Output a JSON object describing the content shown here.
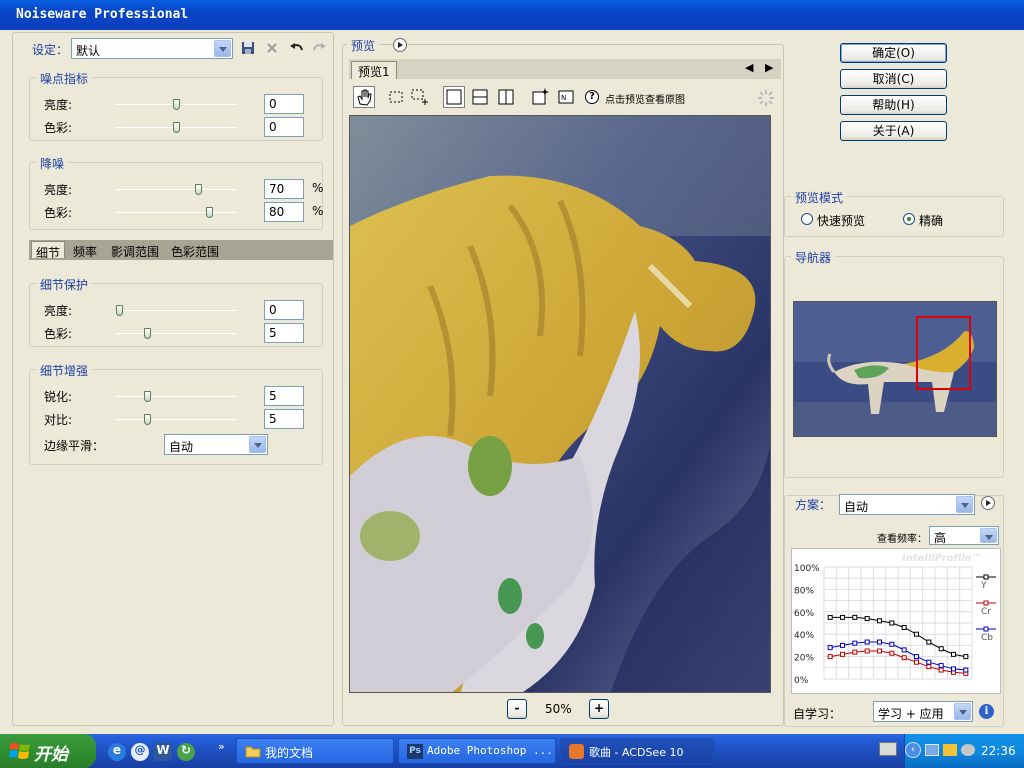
{
  "title": "Noiseware Professional",
  "left": {
    "preset_label": "设定：",
    "preset_value": "默认",
    "noise_group": "噪点指标",
    "reduce_group": "降噪",
    "brightness": "亮度:",
    "color": "色彩:",
    "noise_luma": "0",
    "noise_chroma": "0",
    "reduce_luma": "70",
    "reduce_chroma": "80",
    "percent": "%",
    "tabs": [
      "细节",
      "频率",
      "影调范围",
      "色彩范围"
    ],
    "detail_protect_group": "细节保护",
    "protect_luma": "0",
    "protect_chroma": "5",
    "detail_enhance_group": "细节增强",
    "sharpen_label": "锐化:",
    "contrast_label": "对比:",
    "sharpen_value": "5",
    "contrast_value": "5",
    "edge_label": "边缘平滑：",
    "edge_value": "自动"
  },
  "sliders": {
    "noise_luma": 0.5,
    "noise_chroma": 0.5,
    "reduce_luma": 0.7,
    "reduce_chroma": 0.8,
    "protect_luma": 0.0,
    "protect_chroma": 0.25,
    "sharpen": 0.25,
    "contrast": 0.25
  },
  "preview": {
    "section_label": "预览",
    "tab_label": "预览1",
    "hint": "点击预览查看原图",
    "zoom": "50%",
    "zoom_minus": "-",
    "zoom_plus": "+"
  },
  "buttons": {
    "ok": "确定(O)",
    "cancel": "取消(C)",
    "help": "帮助(H)",
    "about": "关于(A)"
  },
  "preview_mode": {
    "group": "预览模式",
    "fast": "快速预览",
    "accurate": "精确",
    "selected": "accurate"
  },
  "navigator": {
    "group": "导航器"
  },
  "profile": {
    "scheme_label": "方案：",
    "scheme_value": "自动",
    "freq_label": "查看频率：",
    "freq_value": "高",
    "logo": "IntelliProfile™",
    "learn_label": "自学习：",
    "learn_value": "学习 + 应用"
  },
  "chart_data": {
    "type": "line",
    "x": [
      1,
      2,
      3,
      4,
      5,
      6,
      7,
      8,
      9,
      10,
      11,
      12
    ],
    "yticks": [
      "100%",
      "80%",
      "60%",
      "40%",
      "20%",
      "0%"
    ],
    "ylim": [
      0,
      100
    ],
    "series": [
      {
        "name": "Y",
        "color": "#000000",
        "values": [
          55,
          55,
          55,
          54,
          52,
          50,
          46,
          40,
          33,
          27,
          22,
          20
        ]
      },
      {
        "name": "Cr",
        "color": "#c00000",
        "values": [
          20,
          22,
          24,
          25,
          25,
          23,
          19,
          15,
          11,
          8,
          6,
          5
        ]
      },
      {
        "name": "Cb",
        "color": "#0000c0",
        "values": [
          28,
          30,
          32,
          33,
          33,
          31,
          26,
          20,
          15,
          12,
          9,
          8
        ]
      }
    ]
  },
  "taskbar": {
    "start": "开始",
    "tasks": [
      "我的文档",
      "Adobe Photoshop ...",
      "歌曲 - ACDSee 10"
    ],
    "clock": "22:36"
  },
  "colors": {
    "accent_blue": "#1c3fa3",
    "nav_box": "#e00000"
  }
}
